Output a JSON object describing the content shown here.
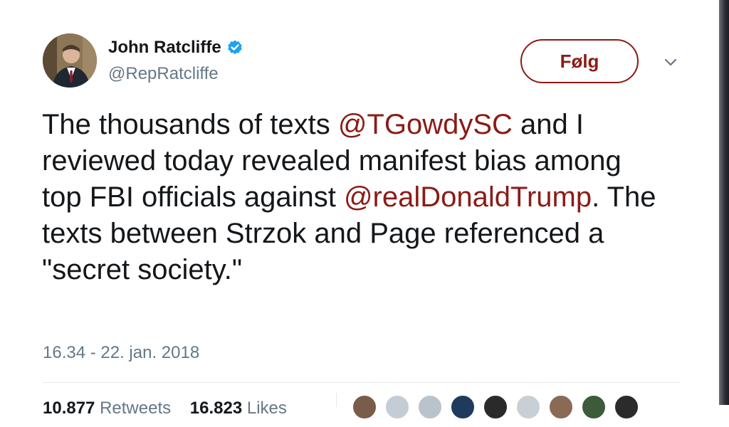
{
  "tweet": {
    "author_name": "John Ratcliffe",
    "author_handle": "@RepRatcliffe",
    "follow_label": "Følg",
    "text_segments": {
      "s1": "The thousands of texts ",
      "m1": "@TGowdySC",
      "s2": " and I reviewed today revealed manifest bias among top FBI officials against ",
      "m2": "@realDonaldTrump",
      "s3": ". The texts between Strzok and Page referenced a \"secret society.\""
    },
    "timestamp": "16.34 - 22. jan. 2018",
    "retweets_count": "10.877",
    "retweets_label": "Retweets",
    "likes_count": "16.823",
    "likes_label": "Likes"
  },
  "colors": {
    "accent": "#8b1b16",
    "verified_blue": "#1da1f2",
    "secondary_text": "#657786",
    "primary_text": "#14171a"
  },
  "icons": [
    "avatar",
    "verified-badge-icon",
    "chevron-down-icon"
  ]
}
